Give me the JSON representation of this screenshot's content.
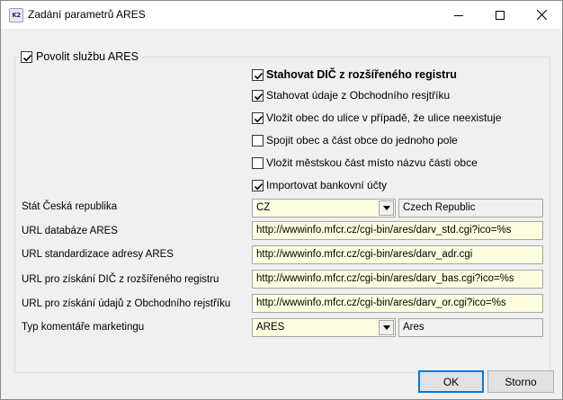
{
  "window": {
    "icon_text": "K2",
    "title": "Zadání parametrů ARES"
  },
  "group": {
    "enable_label": "Povolit službu ARES",
    "enable_checked": true
  },
  "options": [
    {
      "label": "Stahovat DIČ z rozšířeného registru",
      "checked": true,
      "bold": true
    },
    {
      "label": "Stahovat údaje z Obchodního resjtříku",
      "checked": true,
      "bold": false
    },
    {
      "label": "Vložit obec do ulice v případě, že ulice neexistuje",
      "checked": true,
      "bold": false
    },
    {
      "label": "Spojit obec a část obce do jednoho pole",
      "checked": false,
      "bold": false
    },
    {
      "label": "Vložit městskou část místo názvu části obce",
      "checked": false,
      "bold": false
    },
    {
      "label": "Importovat bankovní účty",
      "checked": true,
      "bold": false
    }
  ],
  "fields": {
    "state_label": "Stát Česká republika",
    "state_value": "CZ",
    "state_name": "Czech Republic",
    "url_db_label": "URL databáze ARES",
    "url_db_value": "http://wwwinfo.mfcr.cz/cgi-bin/ares/darv_std.cgi?ico=%s",
    "url_std_label": "URL standardizace adresy ARES",
    "url_std_value": "http://wwwinfo.mfcr.cz/cgi-bin/ares/darv_adr.cgi",
    "url_dic_label": "URL pro získání DIČ z rozšířeného registru",
    "url_dic_value": "http://wwwinfo.mfcr.cz/cgi-bin/ares/darv_bas.cgi?ico=%s",
    "url_or_label": "URL pro získání údajů z Obchodního rejstříku",
    "url_or_value": "http://wwwinfo.mfcr.cz/cgi-bin/ares/darv_or.cgi?ico=%s",
    "comment_label": "Typ komentáře marketingu",
    "comment_value": "ARES",
    "comment_name": "Ares"
  },
  "buttons": {
    "ok": "OK",
    "cancel": "Storno"
  },
  "colors": {
    "field_bg": "#fffde0",
    "default_button_border": "#0078d7"
  },
  "icons": [
    "app-icon",
    "minimize-icon",
    "maximize-icon",
    "close-icon",
    "checkmark-icon",
    "dropdown-arrow-icon"
  ]
}
